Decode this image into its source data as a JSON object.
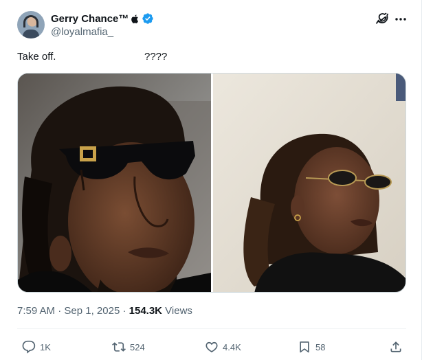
{
  "author": {
    "display_name": "Gerry Chance™",
    "handle": "@loyalmafia_",
    "avatar_icon": "avatar",
    "badge_icons": [
      "apple-icon",
      "verified-icon"
    ],
    "verified_color": "#1d9bf0"
  },
  "tweet": {
    "text_part1": "Take off.",
    "text_part2": "????"
  },
  "media": {
    "images": [
      {
        "subject": "man-with-sunglasses"
      },
      {
        "subject": "woman-with-sunglasses"
      }
    ]
  },
  "meta": {
    "time": "7:59 AM",
    "dot1": " · ",
    "date": "Sep 1, 2025",
    "dot2": " · ",
    "views_count": "154.3K",
    "views_label": " Views"
  },
  "actions": {
    "replies": "1K",
    "reposts": "524",
    "likes": "4.4K",
    "bookmarks": "58"
  },
  "colors": {
    "text_primary": "#0f1419",
    "text_secondary": "#536471",
    "accent": "#1d9bf0"
  }
}
